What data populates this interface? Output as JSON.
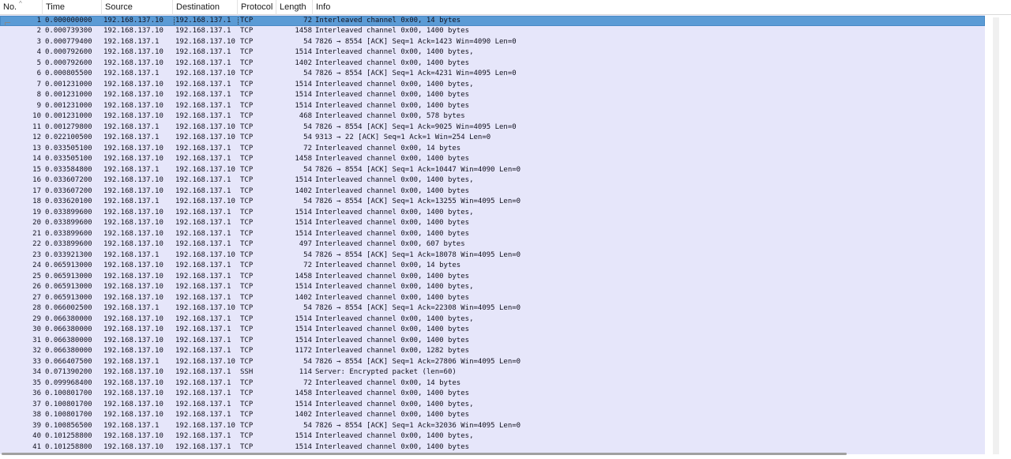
{
  "packet_list": {
    "columns": [
      {
        "key": "no",
        "label": "No."
      },
      {
        "key": "time",
        "label": "Time"
      },
      {
        "key": "source",
        "label": "Source"
      },
      {
        "key": "destination",
        "label": "Destination"
      },
      {
        "key": "protocol",
        "label": "Protocol"
      },
      {
        "key": "length",
        "label": "Length"
      },
      {
        "key": "info",
        "label": "Info"
      }
    ],
    "sort_indicator": "^",
    "selected_row": 1,
    "rows": [
      {
        "no": "1",
        "time": "0.000000000",
        "source": "192.168.137.10",
        "destination": "192.168.137.1",
        "protocol": "TCP",
        "length": "72",
        "info": "Interleaved channel 0x00, 14 bytes"
      },
      {
        "no": "2",
        "time": "0.000739300",
        "source": "192.168.137.10",
        "destination": "192.168.137.1",
        "protocol": "TCP",
        "length": "1458",
        "info": "Interleaved channel 0x00, 1400 bytes"
      },
      {
        "no": "3",
        "time": "0.000779400",
        "source": "192.168.137.1",
        "destination": "192.168.137.10",
        "protocol": "TCP",
        "length": "54",
        "info": "7826 → 8554 [ACK] Seq=1 Ack=1423 Win=4090 Len=0"
      },
      {
        "no": "4",
        "time": "0.000792600",
        "source": "192.168.137.10",
        "destination": "192.168.137.1",
        "protocol": "TCP",
        "length": "1514",
        "info": "Interleaved channel 0x00, 1400 bytes,"
      },
      {
        "no": "5",
        "time": "0.000792600",
        "source": "192.168.137.10",
        "destination": "192.168.137.1",
        "protocol": "TCP",
        "length": "1402",
        "info": "Interleaved channel 0x00, 1400 bytes"
      },
      {
        "no": "6",
        "time": "0.000805500",
        "source": "192.168.137.1",
        "destination": "192.168.137.10",
        "protocol": "TCP",
        "length": "54",
        "info": "7826 → 8554 [ACK] Seq=1 Ack=4231 Win=4095 Len=0"
      },
      {
        "no": "7",
        "time": "0.001231000",
        "source": "192.168.137.10",
        "destination": "192.168.137.1",
        "protocol": "TCP",
        "length": "1514",
        "info": "Interleaved channel 0x00, 1400 bytes,"
      },
      {
        "no": "8",
        "time": "0.001231000",
        "source": "192.168.137.10",
        "destination": "192.168.137.1",
        "protocol": "TCP",
        "length": "1514",
        "info": "Interleaved channel 0x00, 1400 bytes"
      },
      {
        "no": "9",
        "time": "0.001231000",
        "source": "192.168.137.10",
        "destination": "192.168.137.1",
        "protocol": "TCP",
        "length": "1514",
        "info": "Interleaved channel 0x00, 1400 bytes"
      },
      {
        "no": "10",
        "time": "0.001231000",
        "source": "192.168.137.10",
        "destination": "192.168.137.1",
        "protocol": "TCP",
        "length": "468",
        "info": "Interleaved channel 0x00, 578 bytes"
      },
      {
        "no": "11",
        "time": "0.001279800",
        "source": "192.168.137.1",
        "destination": "192.168.137.10",
        "protocol": "TCP",
        "length": "54",
        "info": "7826 → 8554 [ACK] Seq=1 Ack=9025 Win=4095 Len=0"
      },
      {
        "no": "12",
        "time": "0.022100500",
        "source": "192.168.137.1",
        "destination": "192.168.137.10",
        "protocol": "TCP",
        "length": "54",
        "info": "9313 → 22 [ACK] Seq=1 Ack=1 Win=254 Len=0"
      },
      {
        "no": "13",
        "time": "0.033505100",
        "source": "192.168.137.10",
        "destination": "192.168.137.1",
        "protocol": "TCP",
        "length": "72",
        "info": "Interleaved channel 0x00, 14 bytes"
      },
      {
        "no": "14",
        "time": "0.033505100",
        "source": "192.168.137.10",
        "destination": "192.168.137.1",
        "protocol": "TCP",
        "length": "1458",
        "info": "Interleaved channel 0x00, 1400 bytes"
      },
      {
        "no": "15",
        "time": "0.033584800",
        "source": "192.168.137.1",
        "destination": "192.168.137.10",
        "protocol": "TCP",
        "length": "54",
        "info": "7826 → 8554 [ACK] Seq=1 Ack=10447 Win=4090 Len=0"
      },
      {
        "no": "16",
        "time": "0.033607200",
        "source": "192.168.137.10",
        "destination": "192.168.137.1",
        "protocol": "TCP",
        "length": "1514",
        "info": "Interleaved channel 0x00, 1400 bytes,"
      },
      {
        "no": "17",
        "time": "0.033607200",
        "source": "192.168.137.10",
        "destination": "192.168.137.1",
        "protocol": "TCP",
        "length": "1402",
        "info": "Interleaved channel 0x00, 1400 bytes"
      },
      {
        "no": "18",
        "time": "0.033620100",
        "source": "192.168.137.1",
        "destination": "192.168.137.10",
        "protocol": "TCP",
        "length": "54",
        "info": "7826 → 8554 [ACK] Seq=1 Ack=13255 Win=4095 Len=0"
      },
      {
        "no": "19",
        "time": "0.033899600",
        "source": "192.168.137.10",
        "destination": "192.168.137.1",
        "protocol": "TCP",
        "length": "1514",
        "info": "Interleaved channel 0x00, 1400 bytes,"
      },
      {
        "no": "20",
        "time": "0.033899600",
        "source": "192.168.137.10",
        "destination": "192.168.137.1",
        "protocol": "TCP",
        "length": "1514",
        "info": "Interleaved channel 0x00, 1400 bytes"
      },
      {
        "no": "21",
        "time": "0.033899600",
        "source": "192.168.137.10",
        "destination": "192.168.137.1",
        "protocol": "TCP",
        "length": "1514",
        "info": "Interleaved channel 0x00, 1400 bytes"
      },
      {
        "no": "22",
        "time": "0.033899600",
        "source": "192.168.137.10",
        "destination": "192.168.137.1",
        "protocol": "TCP",
        "length": "497",
        "info": "Interleaved channel 0x00, 607 bytes"
      },
      {
        "no": "23",
        "time": "0.033921300",
        "source": "192.168.137.1",
        "destination": "192.168.137.10",
        "protocol": "TCP",
        "length": "54",
        "info": "7826 → 8554 [ACK] Seq=1 Ack=18078 Win=4095 Len=0"
      },
      {
        "no": "24",
        "time": "0.065913000",
        "source": "192.168.137.10",
        "destination": "192.168.137.1",
        "protocol": "TCP",
        "length": "72",
        "info": "Interleaved channel 0x00, 14 bytes"
      },
      {
        "no": "25",
        "time": "0.065913000",
        "source": "192.168.137.10",
        "destination": "192.168.137.1",
        "protocol": "TCP",
        "length": "1458",
        "info": "Interleaved channel 0x00, 1400 bytes"
      },
      {
        "no": "26",
        "time": "0.065913000",
        "source": "192.168.137.10",
        "destination": "192.168.137.1",
        "protocol": "TCP",
        "length": "1514",
        "info": "Interleaved channel 0x00, 1400 bytes,"
      },
      {
        "no": "27",
        "time": "0.065913000",
        "source": "192.168.137.10",
        "destination": "192.168.137.1",
        "protocol": "TCP",
        "length": "1402",
        "info": "Interleaved channel 0x00, 1400 bytes"
      },
      {
        "no": "28",
        "time": "0.066002500",
        "source": "192.168.137.1",
        "destination": "192.168.137.10",
        "protocol": "TCP",
        "length": "54",
        "info": "7826 → 8554 [ACK] Seq=1 Ack=22308 Win=4095 Len=0"
      },
      {
        "no": "29",
        "time": "0.066380000",
        "source": "192.168.137.10",
        "destination": "192.168.137.1",
        "protocol": "TCP",
        "length": "1514",
        "info": "Interleaved channel 0x00, 1400 bytes,"
      },
      {
        "no": "30",
        "time": "0.066380000",
        "source": "192.168.137.10",
        "destination": "192.168.137.1",
        "protocol": "TCP",
        "length": "1514",
        "info": "Interleaved channel 0x00, 1400 bytes"
      },
      {
        "no": "31",
        "time": "0.066380000",
        "source": "192.168.137.10",
        "destination": "192.168.137.1",
        "protocol": "TCP",
        "length": "1514",
        "info": "Interleaved channel 0x00, 1400 bytes"
      },
      {
        "no": "32",
        "time": "0.066380000",
        "source": "192.168.137.10",
        "destination": "192.168.137.1",
        "protocol": "TCP",
        "length": "1172",
        "info": "Interleaved channel 0x00, 1282 bytes"
      },
      {
        "no": "33",
        "time": "0.066407500",
        "source": "192.168.137.1",
        "destination": "192.168.137.10",
        "protocol": "TCP",
        "length": "54",
        "info": "7826 → 8554 [ACK] Seq=1 Ack=27806 Win=4095 Len=0"
      },
      {
        "no": "34",
        "time": "0.071390200",
        "source": "192.168.137.10",
        "destination": "192.168.137.1",
        "protocol": "SSH",
        "length": "114",
        "info": "Server: Encrypted packet (len=60)"
      },
      {
        "no": "35",
        "time": "0.099968400",
        "source": "192.168.137.10",
        "destination": "192.168.137.1",
        "protocol": "TCP",
        "length": "72",
        "info": "Interleaved channel 0x00, 14 bytes"
      },
      {
        "no": "36",
        "time": "0.100801700",
        "source": "192.168.137.10",
        "destination": "192.168.137.1",
        "protocol": "TCP",
        "length": "1458",
        "info": "Interleaved channel 0x00, 1400 bytes"
      },
      {
        "no": "37",
        "time": "0.100801700",
        "source": "192.168.137.10",
        "destination": "192.168.137.1",
        "protocol": "TCP",
        "length": "1514",
        "info": "Interleaved channel 0x00, 1400 bytes,"
      },
      {
        "no": "38",
        "time": "0.100801700",
        "source": "192.168.137.10",
        "destination": "192.168.137.1",
        "protocol": "TCP",
        "length": "1402",
        "info": "Interleaved channel 0x00, 1400 bytes"
      },
      {
        "no": "39",
        "time": "0.100856500",
        "source": "192.168.137.1",
        "destination": "192.168.137.10",
        "protocol": "TCP",
        "length": "54",
        "info": "7826 → 8554 [ACK] Seq=1 Ack=32036 Win=4095 Len=0"
      },
      {
        "no": "40",
        "time": "0.101258800",
        "source": "192.168.137.10",
        "destination": "192.168.137.1",
        "protocol": "TCP",
        "length": "1514",
        "info": "Interleaved channel 0x00, 1400 bytes,"
      },
      {
        "no": "41",
        "time": "0.101258800",
        "source": "192.168.137.10",
        "destination": "192.168.137.1",
        "protocol": "TCP",
        "length": "1514",
        "info": "Interleaved channel 0x00, 1400 bytes"
      }
    ],
    "colors": {
      "row_background": "#e6e6fa",
      "selected_background": "#5b9bd5",
      "header_background": "#ffffff"
    }
  }
}
